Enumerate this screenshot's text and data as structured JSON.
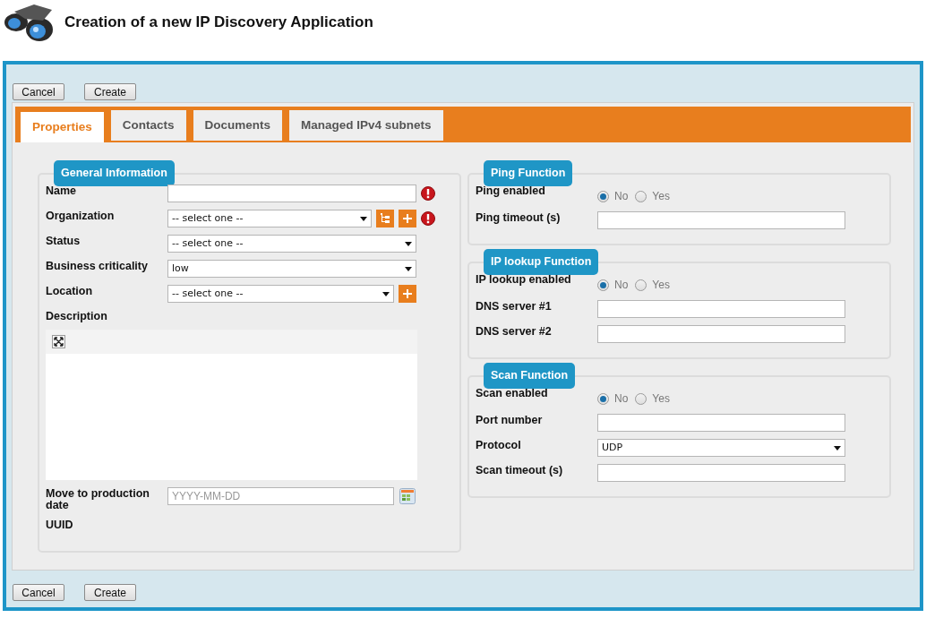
{
  "header": {
    "title": "Creation of a new IP Discovery Application"
  },
  "top_buttons": [
    "Cancel",
    "Create"
  ],
  "tabs": [
    {
      "label": "Properties",
      "selected": true
    },
    {
      "label": "Contacts",
      "selected": false
    },
    {
      "label": "Documents",
      "selected": false
    },
    {
      "label": "Managed IPv4 subnets",
      "selected": false
    }
  ],
  "columns": [
    {
      "sections": [
        {
          "title": "General Information",
          "fields": [
            {
              "label": "Name",
              "kind": "text",
              "tree_button": false,
              "add_button": false,
              "required": true
            },
            {
              "label": "Organization",
              "kind": "select",
              "value": "-- select one --",
              "tree_button": true,
              "add_button": true,
              "required": true
            },
            {
              "label": "Status",
              "kind": "select",
              "value": "-- select one --",
              "tree_button": false,
              "add_button": false,
              "required": false
            },
            {
              "label": "Business criticality",
              "kind": "select",
              "value": "low",
              "tree_button": false,
              "add_button": false,
              "required": false
            },
            {
              "label": "Location",
              "kind": "select",
              "value": "-- select one --",
              "tree_button": false,
              "add_button": true,
              "required": false
            },
            {
              "label": "Description",
              "kind": "editor",
              "tree_button": false,
              "add_button": false,
              "required": false
            },
            {
              "label": "Move to production date",
              "kind": "date",
              "placeholder": "YYYY-MM-DD",
              "tree_button": false,
              "add_button": false,
              "required": false
            },
            {
              "label": "UUID",
              "kind": "label",
              "tree_button": false,
              "add_button": false,
              "required": false
            }
          ]
        }
      ]
    },
    {
      "sections": [
        {
          "title": "Ping Function",
          "fields": [
            {
              "label": "Ping enabled",
              "kind": "radio",
              "options": [
                {
                  "label": "No",
                  "selected": true
                },
                {
                  "label": "Yes",
                  "selected": false
                }
              ]
            },
            {
              "label": "Ping timeout (s)",
              "kind": "text"
            }
          ]
        },
        {
          "title": "IP lookup Function",
          "fields": [
            {
              "label": "IP lookup enabled",
              "kind": "radio",
              "options": [
                {
                  "label": "No",
                  "selected": true
                },
                {
                  "label": "Yes",
                  "selected": false
                }
              ]
            },
            {
              "label": "DNS server #1",
              "kind": "text"
            },
            {
              "label": "DNS server #2",
              "kind": "text"
            }
          ]
        },
        {
          "title": "Scan Function",
          "fields": [
            {
              "label": "Scan enabled",
              "kind": "radio",
              "options": [
                {
                  "label": "No",
                  "selected": true
                },
                {
                  "label": "Yes",
                  "selected": false
                }
              ]
            },
            {
              "label": "Port number",
              "kind": "text"
            },
            {
              "label": "Protocol",
              "kind": "select",
              "value": "UDP"
            },
            {
              "label": "Scan timeout (s)",
              "kind": "text"
            }
          ]
        }
      ]
    }
  ],
  "bottom_buttons": [
    "Cancel",
    "Create"
  ]
}
